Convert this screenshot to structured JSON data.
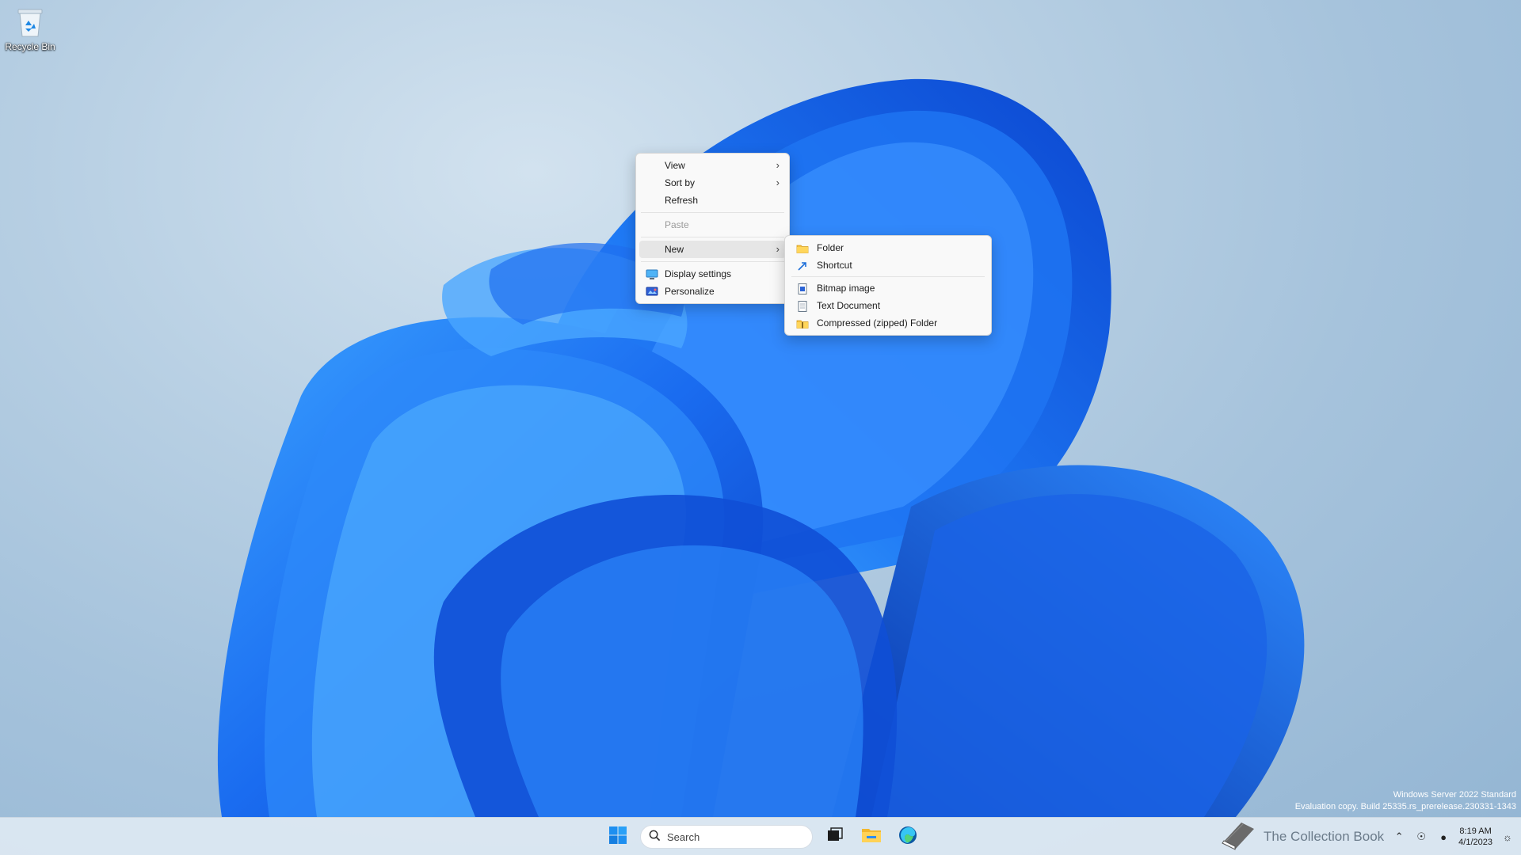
{
  "desktop": {
    "icons": [
      {
        "label": "Recycle Bin",
        "icon": "recycle-bin-icon"
      }
    ]
  },
  "context_menu": {
    "items": {
      "view": {
        "label": "View",
        "has_submenu": true
      },
      "sort_by": {
        "label": "Sort by",
        "has_submenu": true
      },
      "refresh": {
        "label": "Refresh"
      },
      "paste": {
        "label": "Paste",
        "disabled": true
      },
      "new": {
        "label": "New",
        "has_submenu": true,
        "highlighted": true
      },
      "display_settings": {
        "label": "Display settings",
        "icon": "display-icon"
      },
      "personalize": {
        "label": "Personalize",
        "icon": "personalize-icon"
      }
    }
  },
  "new_submenu": {
    "items": {
      "folder": {
        "label": "Folder",
        "icon": "folder-icon"
      },
      "shortcut": {
        "label": "Shortcut",
        "icon": "shortcut-icon"
      },
      "bitmap": {
        "label": "Bitmap image",
        "icon": "bitmap-icon"
      },
      "text_document": {
        "label": "Text Document",
        "icon": "text-document-icon"
      },
      "zip_folder": {
        "label": "Compressed (zipped) Folder",
        "icon": "zip-folder-icon"
      }
    }
  },
  "watermark": {
    "line1": "Windows Server 2022 Standard",
    "line2": "Evaluation copy. Build 25335.rs_prerelease.230331-1343"
  },
  "taskbar": {
    "search_placeholder": "Search",
    "apps": [
      "task-view-icon",
      "file-explorer-icon",
      "edge-icon"
    ],
    "tray": {
      "brand_text": "The Collection Book",
      "time": "8:19 AM",
      "date": "4/1/2023"
    }
  },
  "colors": {
    "menu_bg": "#f9f9f9",
    "menu_hover": "#e6e6e6",
    "accent_blue": "#0067c0",
    "taskbar_bg": "#dee8f2"
  }
}
